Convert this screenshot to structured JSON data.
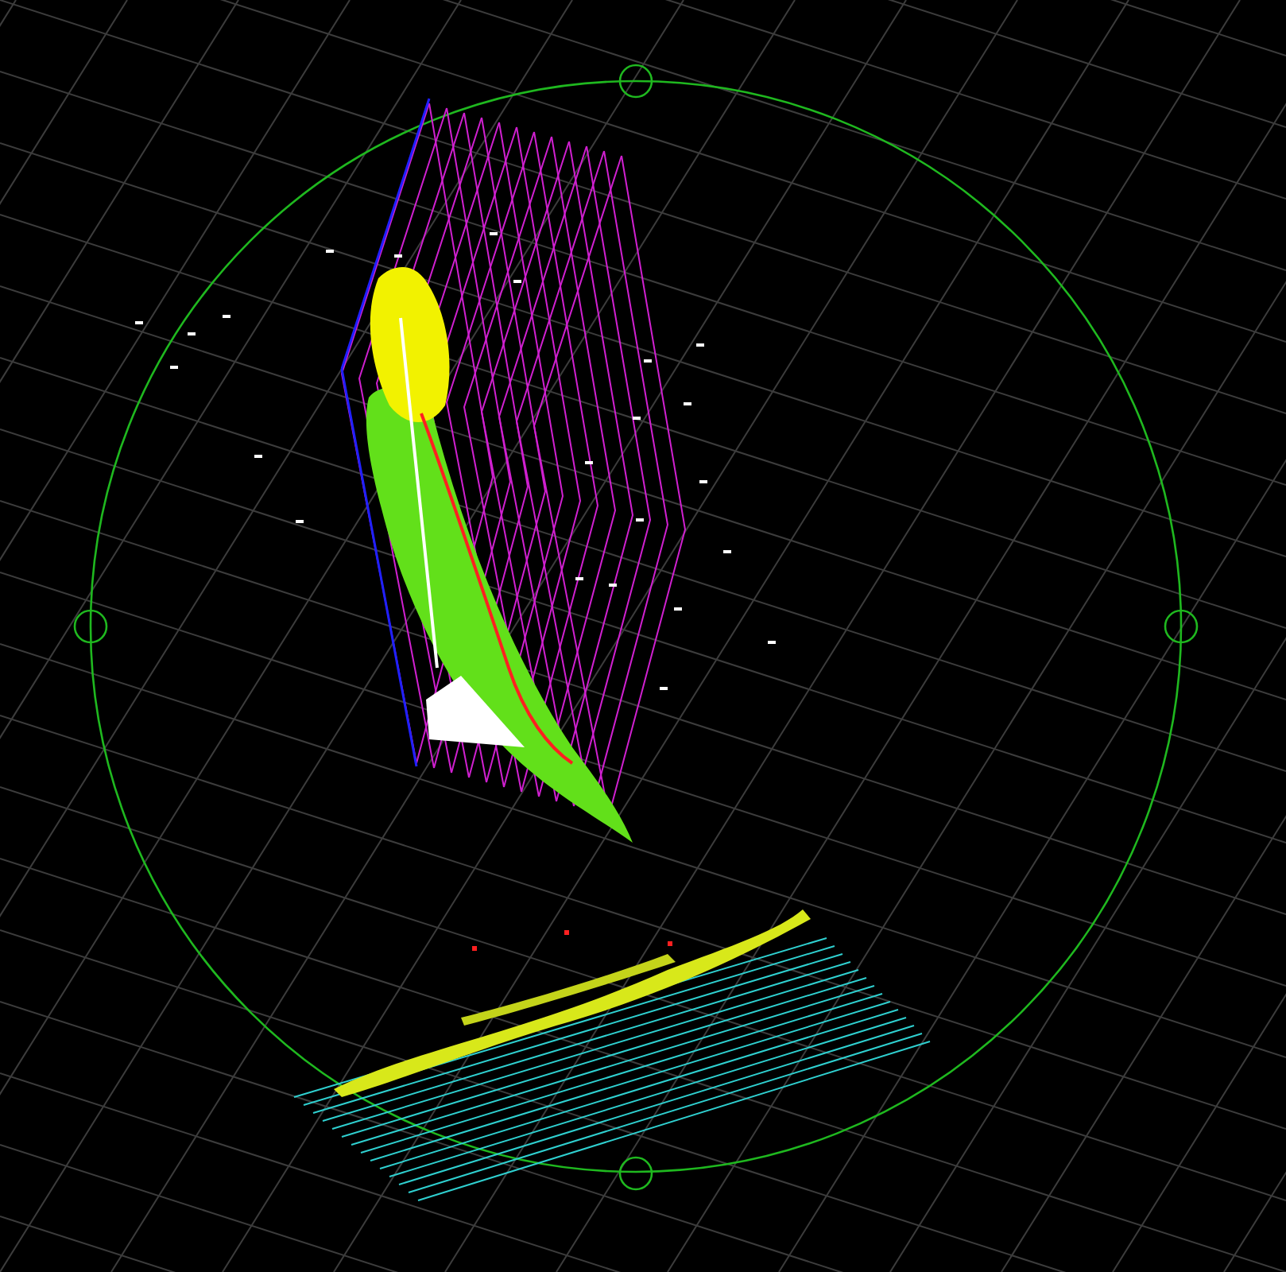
{
  "viewport": {
    "grid": true,
    "orbit_ring": true
  }
}
